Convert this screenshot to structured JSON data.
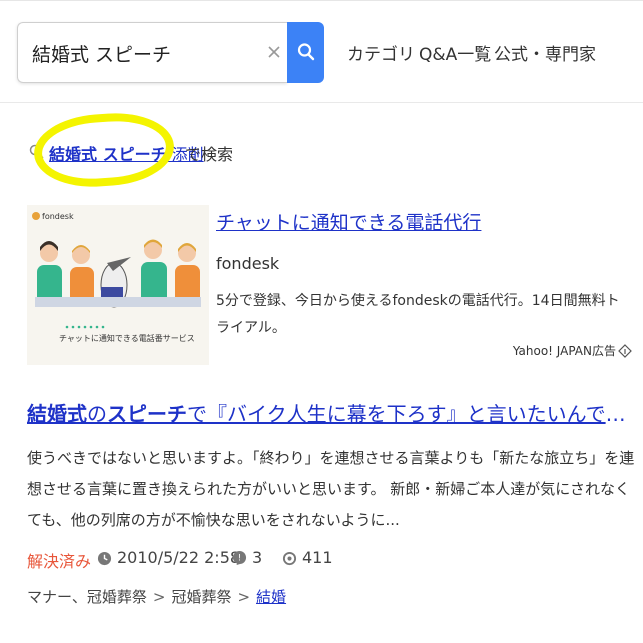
{
  "search": {
    "value": "結婚式 スピーチ",
    "clear_label": "×"
  },
  "nav": {
    "category": "カテゴリ",
    "qa_list": "Q&A一覧",
    "official": "公式・専門家"
  },
  "suggestion": {
    "bold_text": "結婚式 スピーチ",
    "extra_text": " 添削",
    "tail": "で検索"
  },
  "ad": {
    "brand": "fondesk",
    "caption": "チャットに通知できる電話番サービス",
    "title": "チャットに通知できる電話代行",
    "domain": "fondesk",
    "description": "5分で登録、今日から使えるfondeskの電話代行。14日間無料トライアル。",
    "label": "Yahoo! JAPAN広告"
  },
  "result": {
    "title_bold1": "結婚式",
    "title_mid1": "の",
    "title_bold2": "スピーチ",
    "title_rest": "で『バイク人生に幕を下ろす』と言いたいんですが、これは忌…",
    "snippet": "使うべきではないと思いますよ。「終わり」を連想させる言葉よりも「新たな旅立ち」を連想させる言葉に置き換えられた方がいいと思います。 新郎・新婦ご本人達が気にされなくても、他の列席の方が不愉快な思いをされないように...",
    "status": "解決済み",
    "date": "2010/5/22 2:58",
    "answers": "3",
    "views": "411",
    "breadcrumbs": [
      "マナー、冠婚葬祭",
      "冠婚葬祭",
      "結婚"
    ]
  },
  "colors": {
    "accent": "#3c82f6",
    "link": "#1e32c8",
    "solved": "#e8563a",
    "highlight": "#f4f400"
  }
}
